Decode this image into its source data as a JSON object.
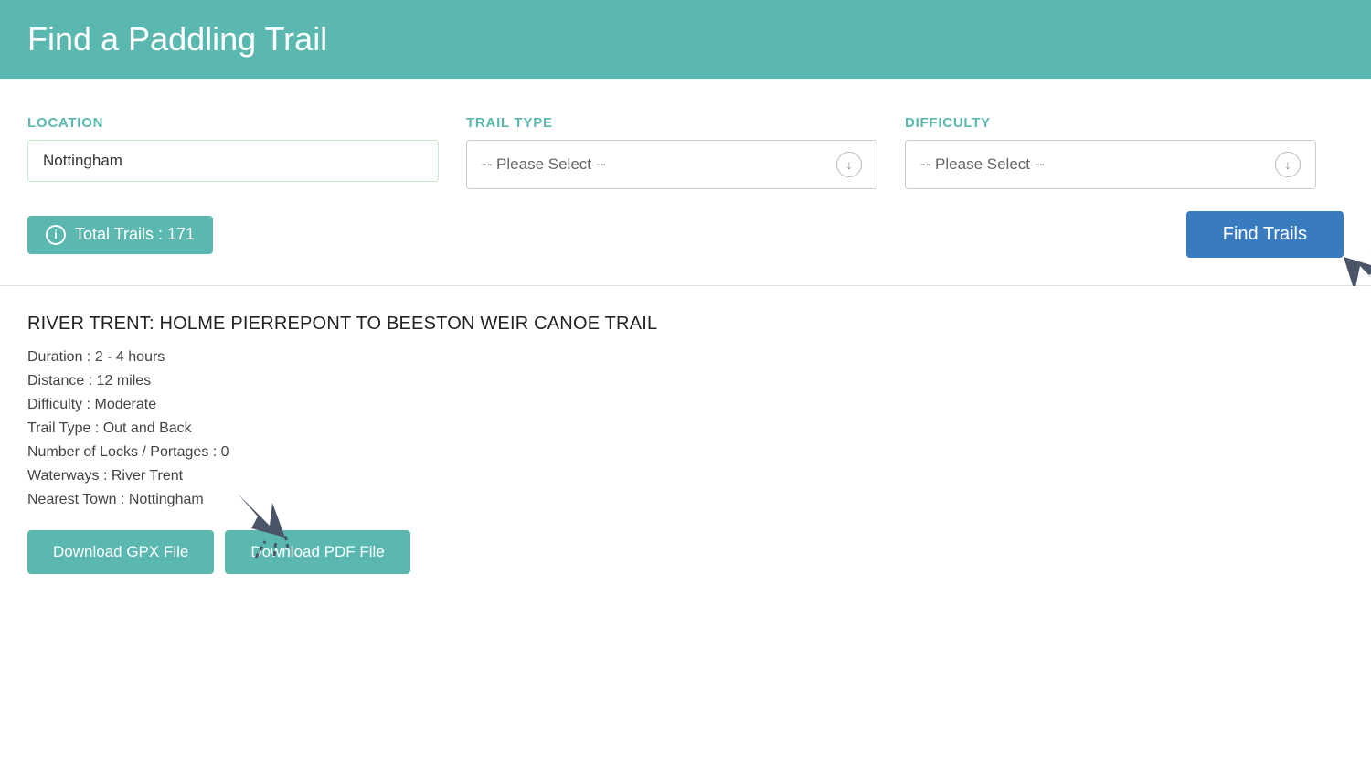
{
  "header": {
    "title": "Find a Paddling Trail"
  },
  "search": {
    "location_label": "LOCATION",
    "location_value": "Nottingham",
    "trail_type_label": "TRAIL TYPE",
    "trail_type_placeholder": "-- Please Select --",
    "difficulty_label": "DIFFICULTY",
    "difficulty_placeholder": "-- Please Select --",
    "total_trails_label": "Total Trails : 171",
    "find_trails_label": "Find Trails"
  },
  "result": {
    "title": "RIVER TRENT: HOLME PIERREPONT TO BEESTON WEIR CANOE TRAIL",
    "duration": "Duration : 2 - 4 hours",
    "distance": "Distance : 12 miles",
    "difficulty": "Difficulty : Moderate",
    "trail_type": "Trail Type : Out and Back",
    "locks": "Number of Locks / Portages : 0",
    "waterways": "Waterways : River Trent",
    "nearest_town": "Nearest Town : Nottingham",
    "download_gpx": "Download GPX File",
    "download_pdf": "Download PDF File"
  }
}
